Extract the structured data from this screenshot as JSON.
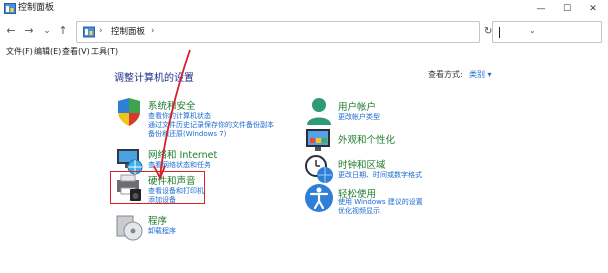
{
  "window": {
    "title": "控制面板",
    "controls": {
      "minimize": "—",
      "maximize": "☐",
      "close": "✕"
    }
  },
  "nav": {
    "back": "←",
    "forward": "→",
    "dropdown": "⌄",
    "up": "↑"
  },
  "address": {
    "separator": "›",
    "location": "控制面板",
    "end_separator": "›",
    "dropdown": "⌄",
    "refresh": "↻"
  },
  "search": {
    "value": ""
  },
  "menu": [
    "文件(F)",
    "编辑(E)",
    "查看(V)",
    "工具(T)"
  ],
  "main": {
    "heading": "调整计算机的设置",
    "view_by_label": "查看方式:",
    "view_by_value": "类别 ▾"
  },
  "categories": {
    "system": {
      "title": "系统和安全",
      "links": [
        "查看你的计算机状态",
        "通过文件历史记录保存你的文件备份副本",
        "备份和还原(Windows 7)"
      ]
    },
    "network": {
      "title": "网络和 Internet",
      "links": [
        "查看网络状态和任务"
      ]
    },
    "hardware": {
      "title": "硬件和声音",
      "links": [
        "查看设备和打印机",
        "添加设备"
      ]
    },
    "programs": {
      "title": "程序",
      "links": [
        "卸载程序"
      ]
    },
    "users": {
      "title": "用户帐户",
      "links": [
        "更改帐户类型"
      ]
    },
    "appearance": {
      "title": "外观和个性化",
      "links": []
    },
    "clock": {
      "title": "时钟和区域",
      "links": [
        "更改日期、时间或数字格式"
      ]
    },
    "ease": {
      "title": "轻松使用",
      "links": [
        "使用 Windows 建议的设置",
        "优化视频显示"
      ]
    }
  },
  "colors": {
    "category_title": "#1e7b2d",
    "link": "#1a6ad1",
    "heading": "#1e3287",
    "highlight": "#d8202a"
  },
  "icons": [
    "control-panel-icon",
    "shield-icon",
    "network-globe-icon",
    "printer-speaker-icon",
    "programs-disc-icon",
    "user-icon",
    "appearance-icon",
    "clock-globe-icon",
    "accessibility-icon"
  ]
}
